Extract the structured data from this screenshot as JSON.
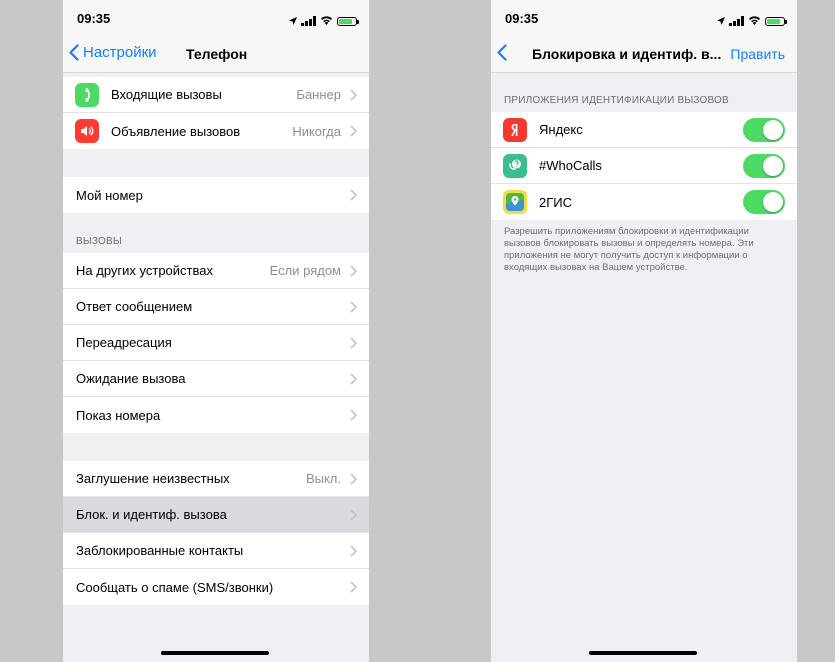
{
  "left": {
    "status": {
      "time": "09:35"
    },
    "nav": {
      "back_label": "Настройки",
      "title": "Телефон"
    },
    "notifications": [
      {
        "label": "Входящие вызовы",
        "value": "Баннер",
        "icon": "phone-icon",
        "color": "#4cd964"
      },
      {
        "label": "Объявление вызовов",
        "value": "Никогда",
        "icon": "speaker-icon",
        "color": "#ff3b30"
      }
    ],
    "my_number": {
      "label": "Мой номер"
    },
    "calls_header": "ВЫЗОВЫ",
    "calls": [
      {
        "label": "На других устройствах",
        "value": "Если рядом"
      },
      {
        "label": "Ответ сообщением",
        "value": ""
      },
      {
        "label": "Переадресация",
        "value": ""
      },
      {
        "label": "Ожидание вызова",
        "value": ""
      },
      {
        "label": "Показ номера",
        "value": ""
      }
    ],
    "blocking": [
      {
        "label": "Заглушение неизвестных",
        "value": "Выкл."
      },
      {
        "label": "Блок. и идентиф. вызова",
        "value": ""
      },
      {
        "label": "Заблокированные контакты",
        "value": ""
      },
      {
        "label": "Сообщать о спаме (SMS/звонки)",
        "value": ""
      }
    ]
  },
  "right": {
    "status": {
      "time": "09:35"
    },
    "nav": {
      "title": "Блокировка и идентиф. в...",
      "action": "Править"
    },
    "section_header": "ПРИЛОЖЕНИЯ ИДЕНТИФИКАЦИИ ВЫЗОВОВ",
    "apps": [
      {
        "label": "Яндекс",
        "enabled": true,
        "icon": "yandex-icon",
        "color": "#f33a2f"
      },
      {
        "label": "#WhoCalls",
        "enabled": true,
        "icon": "whocalls-icon",
        "color": "#3dbd8c"
      },
      {
        "label": "2ГИС",
        "enabled": true,
        "icon": "2gis-icon",
        "color": "#4cb848"
      }
    ],
    "footer": "Разрешить приложениям блокировки и идентификации вызовов блокировать вызовы и определять номера. Эти приложения не могут получить доступ к информации о входящих вызовах на Вашем устройстве.",
    "accent": "#147efb",
    "toggle_on_color": "#4cd964"
  }
}
